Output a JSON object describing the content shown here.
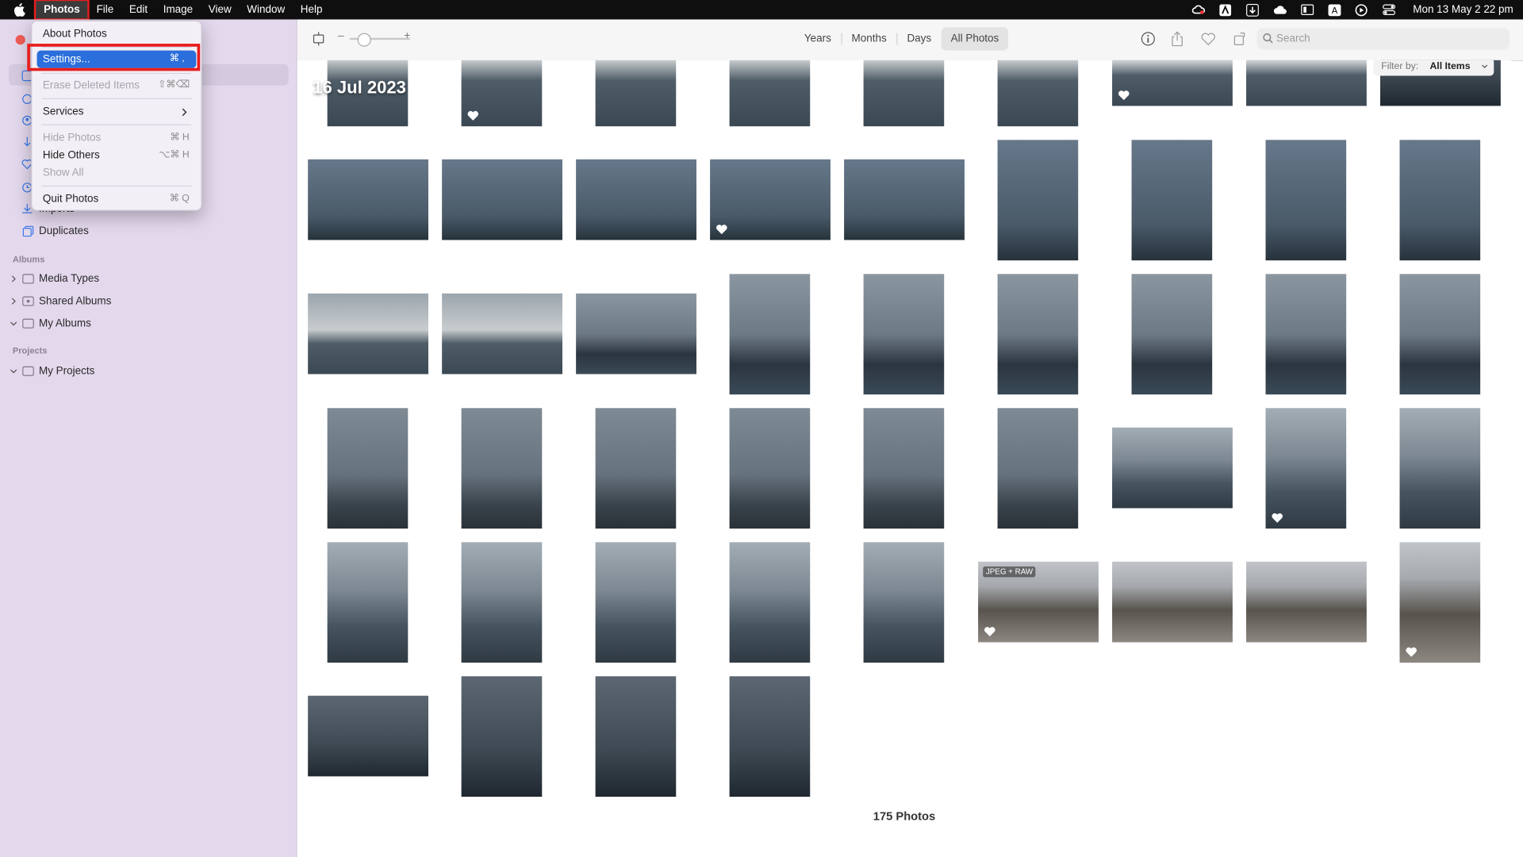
{
  "menubar": {
    "app": "Photos",
    "items": [
      "File",
      "Edit",
      "Image",
      "View",
      "Window",
      "Help"
    ],
    "clock": "Mon 13 May  2 22 pm",
    "status_icons": [
      "creative-cloud-icon",
      "a-box-icon",
      "download-icon",
      "cloud-icon",
      "screen-mirror-icon",
      "keyboard-a-icon",
      "play-circle-icon",
      "control-center-icon"
    ]
  },
  "app_menu": {
    "about": "About Photos",
    "settings": "Settings...",
    "settings_shortcut": "⌘ ,",
    "erase": "Erase Deleted Items",
    "erase_shortcut": "⇧⌘⌫",
    "services": "Services",
    "hide": "Hide Photos",
    "hide_shortcut": "⌘ H",
    "hide_others": "Hide Others",
    "hide_others_shortcut": "⌥⌘ H",
    "show_all": "Show All",
    "quit": "Quit Photos",
    "quit_shortcut": "⌘ Q"
  },
  "sidebar": {
    "partial_item": "Imports",
    "duplicates": "Duplicates",
    "albums_header": "Albums",
    "albums": [
      "Media Types",
      "Shared Albums",
      "My Albums"
    ],
    "projects_header": "Projects",
    "projects": [
      "My Projects"
    ]
  },
  "toolbar": {
    "tabs": [
      "Years",
      "Months",
      "Days",
      "All Photos"
    ],
    "selected_tab": "All Photos",
    "search_placeholder": "Search",
    "zoom_minus": "–",
    "zoom_plus": "+"
  },
  "grid": {
    "date_label": "16 Jul 2023",
    "filter_label": "Filter by:",
    "filter_value": "All Items",
    "raw_badge": "JPEG + RAW",
    "photo_count": "175 Photos"
  }
}
